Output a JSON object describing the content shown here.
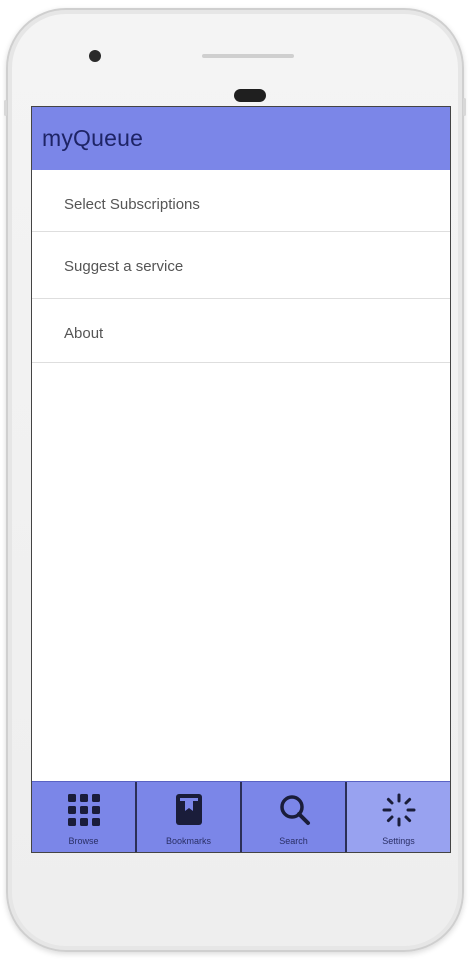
{
  "app": {
    "title": "myQueue"
  },
  "menu": {
    "items": [
      {
        "label": "Select Subscriptions"
      },
      {
        "label": "Suggest a service"
      },
      {
        "label": "About"
      }
    ]
  },
  "bottom_nav": {
    "tabs": [
      {
        "label": "Browse",
        "icon": "grid-icon"
      },
      {
        "label": "Bookmarks",
        "icon": "bookmark-icon"
      },
      {
        "label": "Search",
        "icon": "search-icon"
      },
      {
        "label": "Settings",
        "icon": "spinner-icon",
        "active": true
      }
    ]
  },
  "colors": {
    "primary": "#7b86e8",
    "primary_dark_text": "#1e2466",
    "active_tab": "#98a2f0",
    "divider": "#dedede"
  }
}
